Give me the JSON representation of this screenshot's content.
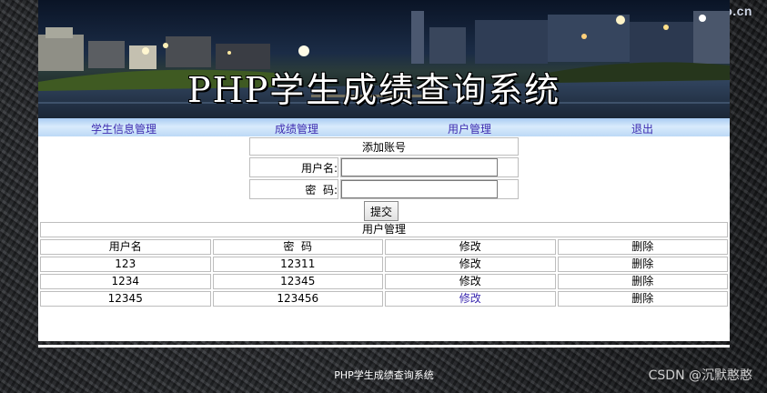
{
  "watermark_top": "by.xmzgo.cn",
  "banner": {
    "title": "PHP学生成绩查询系统"
  },
  "nav": {
    "items": [
      {
        "label": "学生信息管理"
      },
      {
        "label": "成绩管理"
      },
      {
        "label": "用户管理"
      },
      {
        "label": "退出"
      }
    ]
  },
  "add_form": {
    "title": "添加账号",
    "username_label": "用户名:",
    "password_label": "密  码:",
    "username_value": "",
    "password_value": "",
    "submit_label": "提交"
  },
  "user_table": {
    "title": "用户管理",
    "headers": [
      "用户名",
      "密  码",
      "修改",
      "删除"
    ],
    "rows": [
      {
        "username": "123",
        "password": "12311",
        "edit": "修改",
        "delete": "删除"
      },
      {
        "username": "1234",
        "password": "12345",
        "edit": "修改",
        "delete": "删除"
      },
      {
        "username": "12345",
        "password": "123456",
        "edit": "修改",
        "delete": "删除"
      }
    ]
  },
  "footer": {
    "text": "PHP学生成绩查询系统"
  },
  "watermark_bottom": "CSDN @沉默憨憨"
}
